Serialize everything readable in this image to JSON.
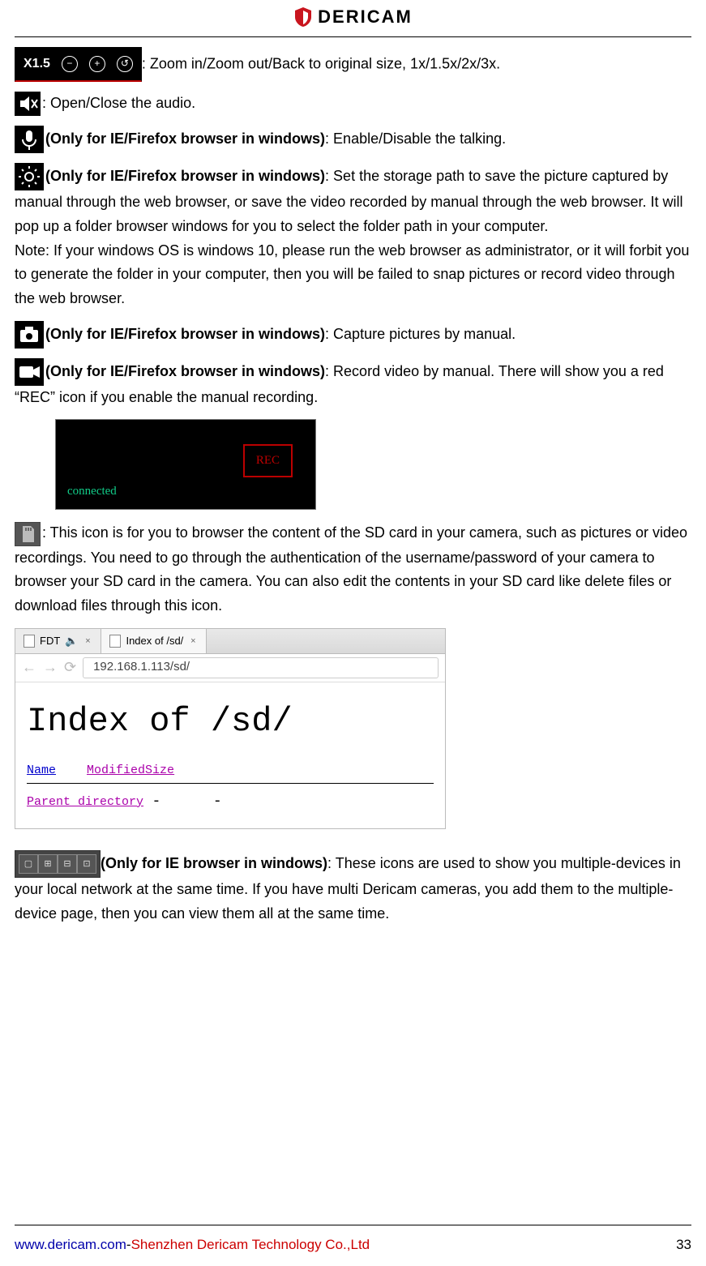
{
  "brand": "DERICAM",
  "items": {
    "zoom": {
      "label": "X1.5",
      "desc": ": Zoom in/Zoom out/Back to original size, 1x/1.5x/2x/3x."
    },
    "audio": {
      "desc": ": Open/Close the audio."
    },
    "talk": {
      "qual": "(Only for IE/Firefox browser in windows)",
      "desc": ": Enable/Disable the talking."
    },
    "path": {
      "qual": "(Only for IE/Firefox browser in windows)",
      "desc": ": Set the storage path to save the picture captured by manual through the web browser, or save the video recorded by manual through the web browser. It will pop up a folder browser windows for you to select the folder path in your computer.",
      "note": "Note: If your windows OS is windows 10, please run the web browser as administrator, or it will forbit you to generate the folder in your computer, then you will be failed to snap pictures or record video through the web browser."
    },
    "capture": {
      "qual": "(Only for IE/Firefox browser in windows)",
      "desc": ": Capture pictures by manual."
    },
    "record": {
      "qual": "(Only for IE/Firefox browser in windows)",
      "desc": ": Record video by manual. There will show you a red “REC” icon if you enable the manual recording."
    },
    "recshot": {
      "connected": "connected",
      "rec": "REC"
    },
    "sd": {
      "desc": ": This icon is for you to browser the content of the SD card in your camera, such as pictures or video recordings. You need to go through the authentication of the username/password of your camera to browser your SD card in the camera. You can also edit the contents in your SD card like delete files or download files through this icon."
    },
    "browser": {
      "tab1": "FDT",
      "tab2": "Index of /sd/",
      "url": "192.168.1.113/sd/",
      "heading": "Index of /sd/",
      "col_name": "Name",
      "col_mod": "Modified",
      "col_size": "Size",
      "parent": "Parent directory",
      "dash": "-"
    },
    "multi": {
      "qual": "(Only for IE browser in windows)",
      "desc": ": These icons are used to show you multiple-devices in your local network at the same time. If you have multi Dericam cameras, you add them to the multiple-device page, then you can view them all at the same time."
    }
  },
  "footer": {
    "site": "www.dericam.com",
    "dash": "-",
    "company": "Shenzhen Dericam Technology Co.,Ltd",
    "page": "33"
  }
}
